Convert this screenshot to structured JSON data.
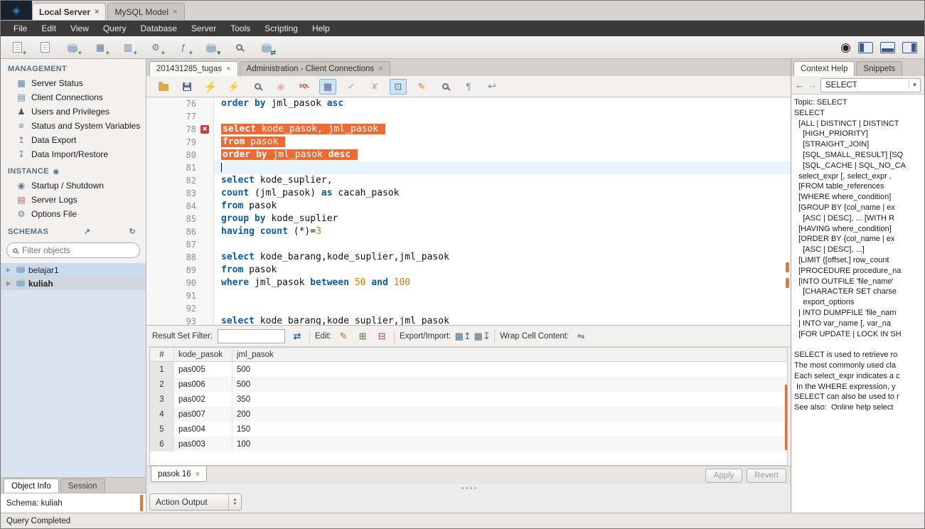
{
  "app": {
    "window_tabs": [
      {
        "label": "Local Server",
        "active": true
      },
      {
        "label": "MySQL Model",
        "active": false
      }
    ],
    "menu": [
      "File",
      "Edit",
      "View",
      "Query",
      "Database",
      "Server",
      "Tools",
      "Scripting",
      "Help"
    ],
    "status_bar": "Query Completed"
  },
  "colors": {
    "selection_orange": "#ED6B32",
    "keyword_blue": "#0B5AA5",
    "number_orange": "#C87A00",
    "error_red": "#D23B3B"
  },
  "main_toolbar": {
    "icons": [
      "new-sql-tab",
      "open-sql-script",
      "create-schema",
      "create-table",
      "create-view",
      "create-procedure",
      "create-function",
      "data-search",
      "search-objects",
      "reconnect-database"
    ],
    "right_icons": [
      "notifications",
      "toggle-left-sidebar",
      "toggle-output-area",
      "toggle-right-sidebar"
    ]
  },
  "sidebar": {
    "management": {
      "title": "MANAGEMENT",
      "items": [
        {
          "icon": "server-status",
          "label": "Server Status"
        },
        {
          "icon": "client-connections",
          "label": "Client Connections"
        },
        {
          "icon": "users-privileges",
          "label": "Users and Privileges"
        },
        {
          "icon": "status-variables",
          "label": "Status and System Variables"
        },
        {
          "icon": "data-export",
          "label": "Data Export"
        },
        {
          "icon": "data-import",
          "label": "Data Import/Restore"
        }
      ]
    },
    "instance": {
      "title": "INSTANCE",
      "items": [
        {
          "icon": "startup-shutdown",
          "label": "Startup / Shutdown"
        },
        {
          "icon": "server-logs",
          "label": "Server Logs"
        },
        {
          "icon": "options-file",
          "label": "Options File"
        }
      ]
    },
    "schemas": {
      "title": "SCHEMAS",
      "filter_placeholder": "Filter objects",
      "items": [
        {
          "label": "belajar1",
          "selected": false
        },
        {
          "label": "kuliah",
          "selected": true
        }
      ]
    },
    "bottom_tabs": [
      {
        "label": "Object Info",
        "active": true
      },
      {
        "label": "Session",
        "active": false
      }
    ],
    "object_info": "Schema: kuliah"
  },
  "editor": {
    "tabs": [
      {
        "label": "201431285_tugas",
        "active": true
      },
      {
        "label": "Administration - Client Connections",
        "active": false
      }
    ],
    "toolbar_icons": [
      {
        "name": "open-sql-script",
        "selected": false
      },
      {
        "name": "save-script",
        "selected": false
      },
      {
        "name": "execute",
        "selected": false
      },
      {
        "name": "execute-current",
        "selected": false
      },
      {
        "name": "explain",
        "selected": false
      },
      {
        "name": "stop",
        "selected": false
      },
      {
        "name": "stop-on-error",
        "selected": false
      },
      {
        "name": "limit-rows",
        "selected": true
      },
      {
        "name": "commit",
        "selected": false
      },
      {
        "name": "rollback",
        "selected": false
      },
      {
        "name": "autocommit",
        "selected": true
      },
      {
        "name": "beautify",
        "selected": false
      },
      {
        "name": "find",
        "selected": false
      },
      {
        "name": "invisibles",
        "selected": false
      },
      {
        "name": "wrap-text",
        "selected": false
      }
    ],
    "code": {
      "lines": [
        {
          "num": 76,
          "tokens": [
            [
              "kw",
              "order by"
            ],
            [
              "pl",
              " jml_pasok "
            ],
            [
              "kw",
              "asc"
            ]
          ]
        },
        {
          "num": 77,
          "tokens": []
        },
        {
          "num": 78,
          "sel": true,
          "err": true,
          "tokens": [
            [
              "kw",
              "select"
            ],
            [
              "pl",
              " kode_pasok, jml_pasok "
            ]
          ]
        },
        {
          "num": 79,
          "sel": true,
          "tokens": [
            [
              "kw",
              "from"
            ],
            [
              "pl",
              " pasok "
            ]
          ]
        },
        {
          "num": 80,
          "sel": true,
          "tokens": [
            [
              "kw",
              "order by"
            ],
            [
              "pl",
              " jml_pasok "
            ],
            [
              "kw",
              "desc"
            ],
            [
              "pl",
              " "
            ]
          ]
        },
        {
          "num": 81,
          "cur": true,
          "tokens": []
        },
        {
          "num": 82,
          "tokens": [
            [
              "kw",
              "select"
            ],
            [
              "pl",
              " kode_suplier,"
            ]
          ]
        },
        {
          "num": 83,
          "tokens": [
            [
              "kw",
              "count"
            ],
            [
              "pl",
              " (jml_pasok) "
            ],
            [
              "kw",
              "as"
            ],
            [
              "pl",
              " cacah_pasok"
            ]
          ]
        },
        {
          "num": 84,
          "tokens": [
            [
              "kw",
              "from"
            ],
            [
              "pl",
              " pasok"
            ]
          ]
        },
        {
          "num": 85,
          "tokens": [
            [
              "kw",
              "group by"
            ],
            [
              "pl",
              " kode_suplier"
            ]
          ]
        },
        {
          "num": 86,
          "tokens": [
            [
              "kw",
              "having"
            ],
            [
              "pl",
              " "
            ],
            [
              "kw",
              "count"
            ],
            [
              "pl",
              " (*)="
            ],
            [
              "num",
              "3"
            ]
          ]
        },
        {
          "num": 87,
          "tokens": []
        },
        {
          "num": 88,
          "tokens": [
            [
              "kw",
              "select"
            ],
            [
              "pl",
              " kode_barang,kode_suplier,jml_pasok"
            ]
          ]
        },
        {
          "num": 89,
          "tokens": [
            [
              "kw",
              "from"
            ],
            [
              "pl",
              " pasok"
            ]
          ]
        },
        {
          "num": 90,
          "tokens": [
            [
              "kw",
              "where"
            ],
            [
              "pl",
              " jml_pasok "
            ],
            [
              "kw",
              "between"
            ],
            [
              "pl",
              " "
            ],
            [
              "num",
              "50"
            ],
            [
              "pl",
              " "
            ],
            [
              "kw",
              "and"
            ],
            [
              "pl",
              " "
            ],
            [
              "num",
              "100"
            ]
          ]
        },
        {
          "num": 91,
          "tokens": []
        },
        {
          "num": 92,
          "tokens": []
        },
        {
          "num": 93,
          "tokens": [
            [
              "kw",
              "select"
            ],
            [
              "pl",
              " kode_barang,kode_suplier,jml_pasok"
            ]
          ]
        }
      ]
    }
  },
  "result": {
    "toolbar": {
      "filter_label": "Result Set Filter:",
      "filter_value": "",
      "edit_label": "Edit:",
      "export_label": "Export/Import:",
      "wrap_label": "Wrap Cell Content:"
    },
    "columns": [
      "#",
      "kode_pasok",
      "jml_pasok"
    ],
    "rows": [
      [
        "1",
        "pas005",
        "500"
      ],
      [
        "2",
        "pas006",
        "500"
      ],
      [
        "3",
        "pas002",
        "350"
      ],
      [
        "4",
        "pas007",
        "200"
      ],
      [
        "5",
        "pas004",
        "150"
      ],
      [
        "6",
        "pas003",
        "100"
      ]
    ],
    "footer": {
      "tab": "pasok 16",
      "apply": "Apply",
      "revert": "Revert"
    }
  },
  "action_output": {
    "label": "Action Output"
  },
  "help": {
    "tabs": [
      {
        "label": "Context Help",
        "active": true
      },
      {
        "label": "Snippets",
        "active": false
      }
    ],
    "combo_value": "SELECT",
    "lines": [
      "Topic: SELECT",
      "SELECT",
      "  [ALL | DISTINCT | DISTINCT",
      "    [HIGH_PRIORITY]",
      "    [STRAIGHT_JOIN]",
      "    [SQL_SMALL_RESULT] [SQ",
      "    [SQL_CACHE | SQL_NO_CA",
      "  select_expr [, select_expr .",
      "  [FROM table_references",
      "  [WHERE where_condition]",
      "  [GROUP BY {col_name | ex",
      "    [ASC | DESC], ... [WITH R",
      "  [HAVING where_condition]",
      "  [ORDER BY {col_name | ex",
      "    [ASC | DESC], ...]",
      "  [LIMIT {[offset,] row_count",
      "  [PROCEDURE procedure_na",
      "  [INTO OUTFILE 'file_name'",
      "    [CHARACTER SET charse",
      "    export_options",
      "  | INTO DUMPFILE 'file_nam",
      "  | INTO var_name [, var_na",
      "  [FOR UPDATE | LOCK IN SH",
      "",
      "SELECT is used to retrieve ro",
      "The most commonly used cla",
      "Each select_expr indicates a c",
      " In the WHERE expression, y",
      "SELECT can also be used to r",
      "See also:  Online help select"
    ]
  }
}
